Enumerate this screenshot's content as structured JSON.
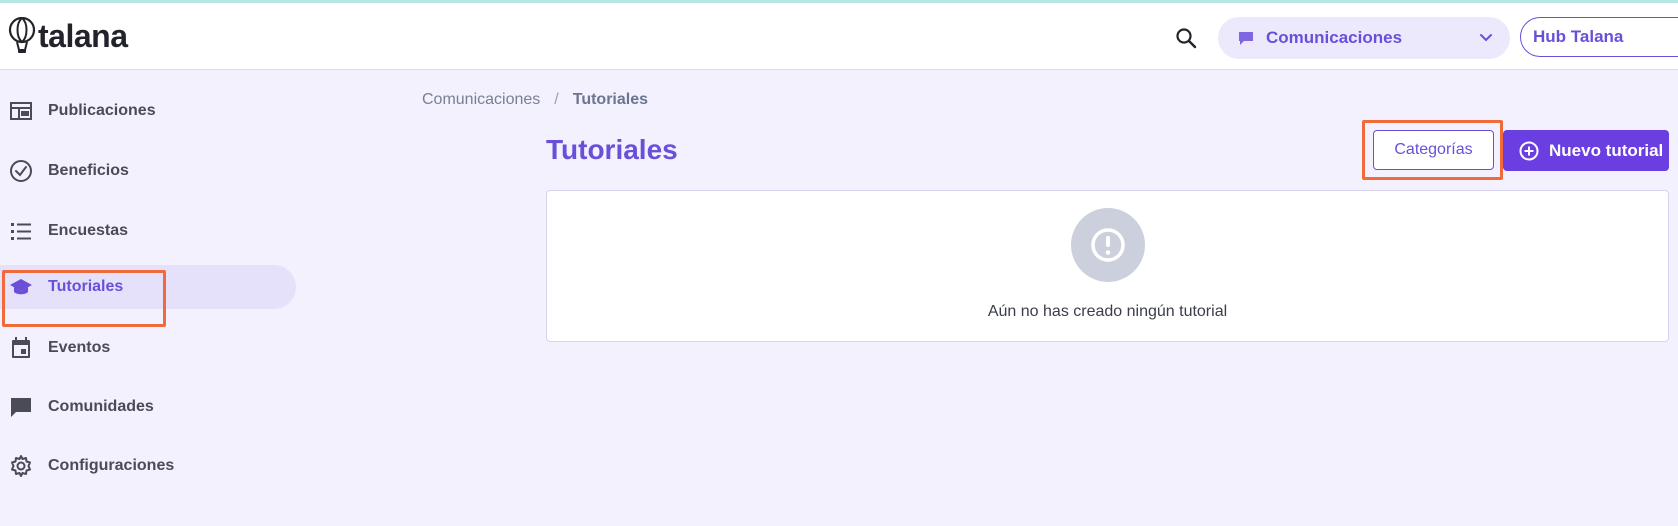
{
  "app": {
    "logo_text": "talana"
  },
  "header": {
    "module_selector": {
      "label": "Comunicaciones",
      "icon": "chat-bubble-icon"
    },
    "hub_button": {
      "label": "Hub Talana"
    }
  },
  "sidebar": {
    "items": [
      {
        "label": "Publicaciones",
        "icon": "newspaper-icon"
      },
      {
        "label": "Beneficios",
        "icon": "check-circle-icon"
      },
      {
        "label": "Encuestas",
        "icon": "list-icon"
      },
      {
        "label": "Tutoriales",
        "icon": "graduation-cap-icon",
        "active": true
      },
      {
        "label": "Eventos",
        "icon": "calendar-icon"
      },
      {
        "label": "Comunidades",
        "icon": "comment-icon"
      },
      {
        "label": "Configuraciones",
        "icon": "gear-icon"
      }
    ]
  },
  "breadcrumb": {
    "parent": "Comunicaciones",
    "separator": "/",
    "current": "Tutoriales"
  },
  "main": {
    "title": "Tutoriales",
    "categories_button": "Categorías",
    "new_button": "Nuevo tutorial",
    "empty_message": "Aún no has creado ningún tutorial"
  },
  "colors": {
    "accent": "#6a4fd9",
    "primary_button": "#6a3ee0",
    "highlight": "#f06a3c",
    "background": "#f3f1fd"
  }
}
